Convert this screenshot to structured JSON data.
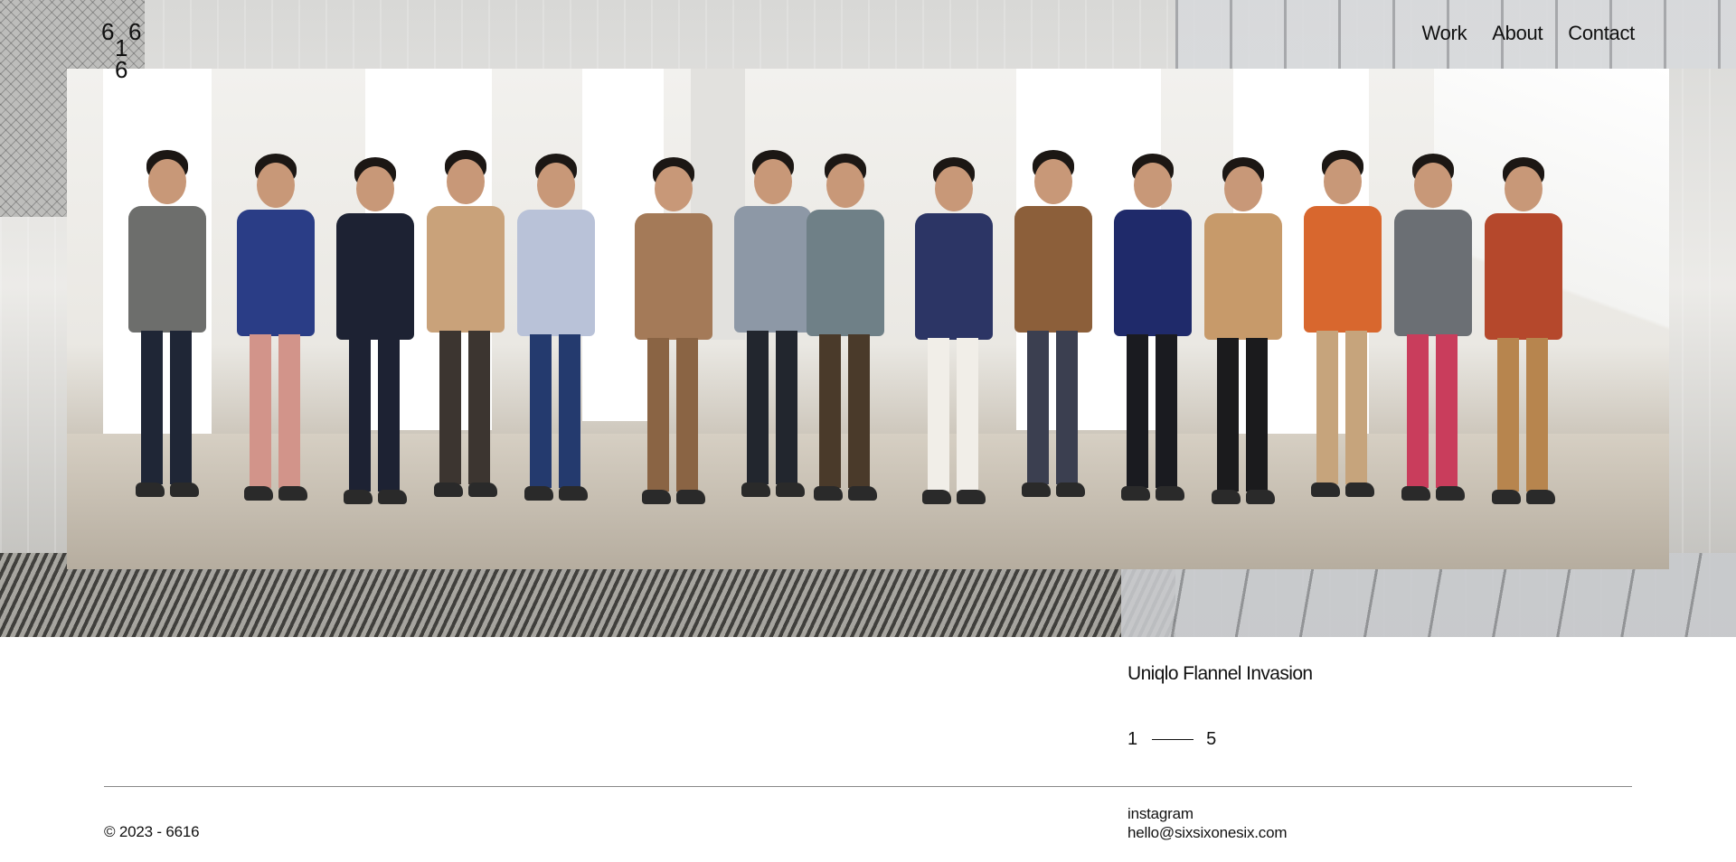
{
  "brand": {
    "logo_glyphs": [
      "6",
      "1",
      "6",
      "6"
    ]
  },
  "nav": {
    "items": [
      {
        "label": "Work"
      },
      {
        "label": "About"
      },
      {
        "label": "Contact"
      }
    ]
  },
  "hero": {
    "image_subject": "group-photo-flannel-shirts"
  },
  "project": {
    "title": "Uniqlo Flannel Invasion",
    "pager_current": "1",
    "pager_total": "5"
  },
  "footer": {
    "copyright": "© 2023 - 6616",
    "instagram_label": "instagram",
    "email": "hello@sixsixonesix.com"
  },
  "colors": {
    "text": "#111111",
    "background": "#ffffff",
    "divider": "#888888"
  }
}
